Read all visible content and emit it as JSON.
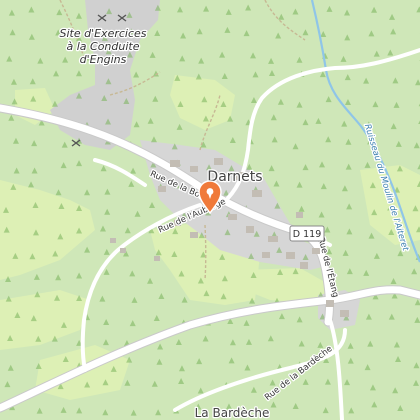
{
  "map": {
    "labels": {
      "place_line1": "Site d'Exercices",
      "place_line2": "à la Conduite",
      "place_line3": "d'Engins",
      "town": "Darnets",
      "road_bourre": "Rue de la Bourre",
      "road_auberge": "Rue de l'Auberge",
      "road_etang": "Rue de l'Étang",
      "road_bardeche": "Rue de la Bardèche",
      "route_badge": "D 119",
      "stream": "Ruisseau du Moulin de l'Aiteret",
      "bottom_place": "La Bardèche"
    },
    "marker": {
      "icon": "map-pin-icon",
      "color": "#f07a3a"
    },
    "colors": {
      "forest": "#cfe7b8",
      "meadow": "#ddf0b5",
      "built": "#d5d5d5",
      "road": "#ffffff",
      "water": "#8fc5e8"
    }
  }
}
